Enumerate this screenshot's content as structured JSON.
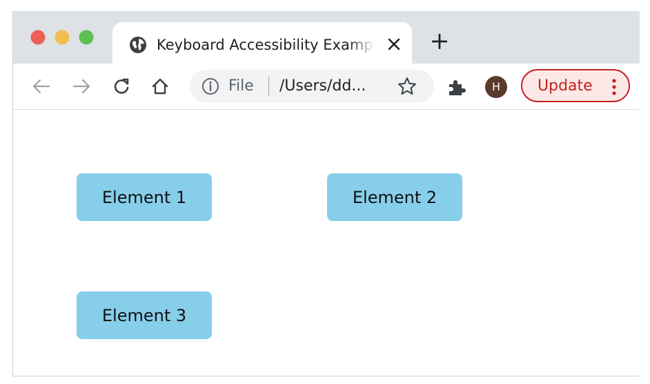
{
  "window": {
    "controls": [
      "close",
      "minimize",
      "zoom"
    ]
  },
  "tab": {
    "title": "Keyboard Accessibility Example",
    "icon": "globe-icon",
    "close_icon": "close-icon"
  },
  "new_tab_icon": "plus-icon",
  "toolbar": {
    "back_icon": "arrow-left-icon",
    "forward_icon": "arrow-right-icon",
    "reload_icon": "reload-icon",
    "home_icon": "home-icon",
    "address": {
      "info_icon": "info-icon",
      "scheme": "File",
      "url": "/Users/dd...",
      "bookmark_icon": "star-icon"
    },
    "extensions_icon": "puzzle-icon",
    "profile_initial": "H",
    "update_label": "Update",
    "menu_icon": "kebab-menu-icon"
  },
  "colors": {
    "element_bg": "#87ceeb",
    "update_text": "#c5221f",
    "avatar_bg": "#5b3a2e",
    "tab_strip": "#dee1e6"
  },
  "page": {
    "elements": [
      "Element 1",
      "Element 2",
      "Element 3"
    ]
  }
}
